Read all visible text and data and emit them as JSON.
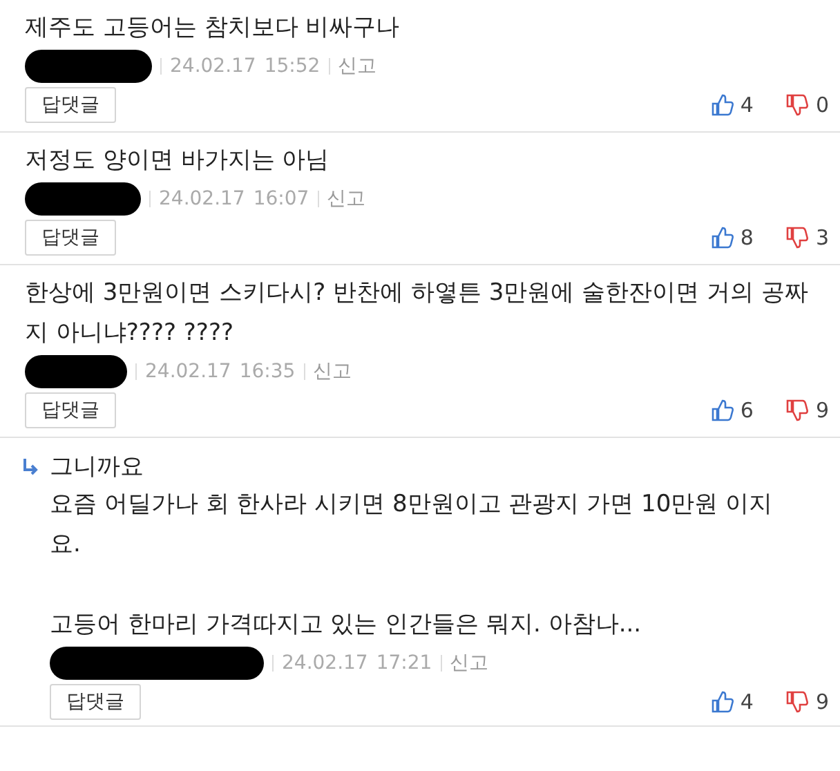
{
  "comments": [
    {
      "kind": "comment",
      "paragraphs": [
        "제주도 고등어는 참치보다 비싸구나"
      ],
      "date": "24.02.17",
      "time": "15:52",
      "report": "신고",
      "reply_button": "답댓글",
      "likes": "4",
      "dislikes": "0"
    },
    {
      "kind": "comment",
      "paragraphs": [
        "저정도 양이면 바가지는 아님"
      ],
      "date": "24.02.17",
      "time": "16:07",
      "report": "신고",
      "reply_button": "답댓글",
      "likes": "8",
      "dislikes": "3"
    },
    {
      "kind": "comment",
      "paragraphs": [
        "한상에 3만원이면 스키다시? 반찬에 하옇튼 3만원에 술한잔이면 거의 공짜지 아니냐???? ????"
      ],
      "date": "24.02.17",
      "time": "16:35",
      "report": "신고",
      "reply_button": "답댓글",
      "likes": "6",
      "dislikes": "9"
    },
    {
      "kind": "reply",
      "title": "그니까요",
      "paragraphs": [
        "요즘 어딜가나 회 한사라 시키면 8만원이고 관광지 가면 10만원 이지요.",
        "고등어 한마리 가격따지고 있는 인간들은 뭐지. 아참나..."
      ],
      "date": "24.02.17",
      "time": "17:21",
      "report": "신고",
      "reply_button": "답댓글",
      "likes": "4",
      "dislikes": "9"
    }
  ]
}
